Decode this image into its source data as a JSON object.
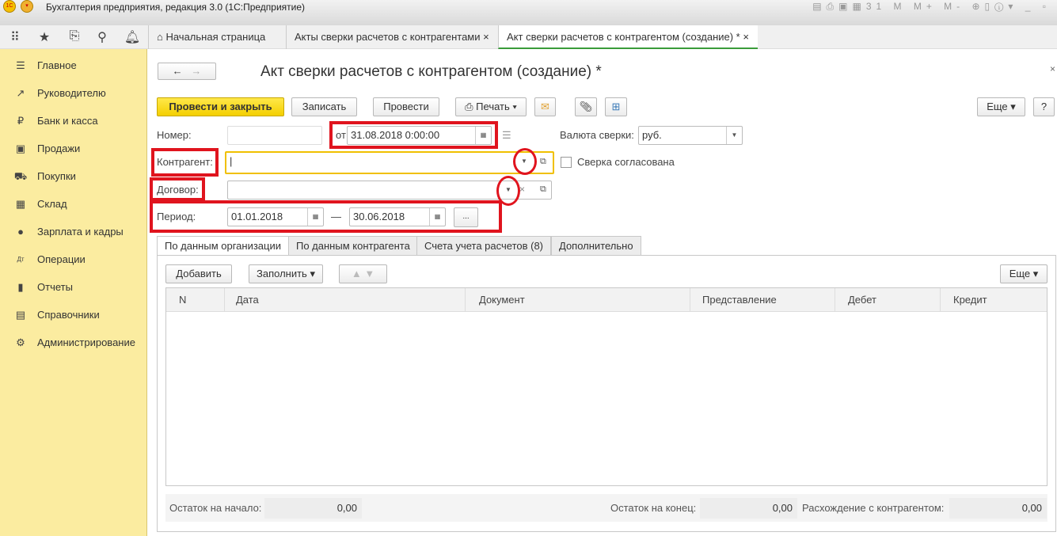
{
  "window": {
    "title": "Бухгалтерия предприятия, редакция 3.0  (1С:Предприятие)"
  },
  "tabs": [
    {
      "label": "Начальная страница"
    },
    {
      "label": "Акты сверки расчетов с контрагентами"
    },
    {
      "label": "Акт сверки расчетов с контрагентом (создание) *"
    }
  ],
  "sidebar": {
    "items": [
      {
        "label": "Главное",
        "icon": "menu-icon"
      },
      {
        "label": "Руководителю",
        "icon": "trend-icon"
      },
      {
        "label": "Банк и касса",
        "icon": "ruble-icon"
      },
      {
        "label": "Продажи",
        "icon": "bag-icon"
      },
      {
        "label": "Покупки",
        "icon": "cart-icon"
      },
      {
        "label": "Склад",
        "icon": "grid-icon"
      },
      {
        "label": "Зарплата и кадры",
        "icon": "person-icon"
      },
      {
        "label": "Операции",
        "icon": "dt-kt-icon"
      },
      {
        "label": "Отчеты",
        "icon": "bar-chart-icon"
      },
      {
        "label": "Справочники",
        "icon": "book-icon"
      },
      {
        "label": "Администрирование",
        "icon": "gear-icon"
      }
    ]
  },
  "form": {
    "title": "Акт сверки расчетов с контрагентом (создание) *",
    "toolbar": {
      "post_close": "Провести и закрыть",
      "save": "Записать",
      "post": "Провести",
      "print": "Печать",
      "more": "Еще",
      "help": "?"
    },
    "number_label": "Номер:",
    "number_value": "",
    "from_label": "от:",
    "date_value": "31.08.2018  0:00:00",
    "currency_label": "Валюта сверки:",
    "currency_value": "руб.",
    "counterparty_label": "Контрагент:",
    "counterparty_value": "",
    "agreed_label": "Сверка согласована",
    "contract_label": "Договор:",
    "contract_value": "",
    "period_label": "Период:",
    "period_from": "01.01.2018",
    "period_dash": "—",
    "period_to": "30.06.2018",
    "period_btn": "...",
    "subtabs": [
      "По данным организации",
      "По данным контрагента",
      "Счета учета расчетов (8)",
      "Дополнительно"
    ],
    "table_toolbar": {
      "add": "Добавить",
      "fill": "Заполнить",
      "more": "Еще"
    },
    "columns": [
      "N",
      "Дата",
      "Документ",
      "Представление",
      "Дебет",
      "Кредит"
    ],
    "footer": {
      "start_label": "Остаток на начало:",
      "start_value": "0,00",
      "end_label": "Остаток на конец:",
      "end_value": "0,00",
      "diff_label": "Расхождение с контрагентом:",
      "diff_value": "0,00"
    }
  }
}
